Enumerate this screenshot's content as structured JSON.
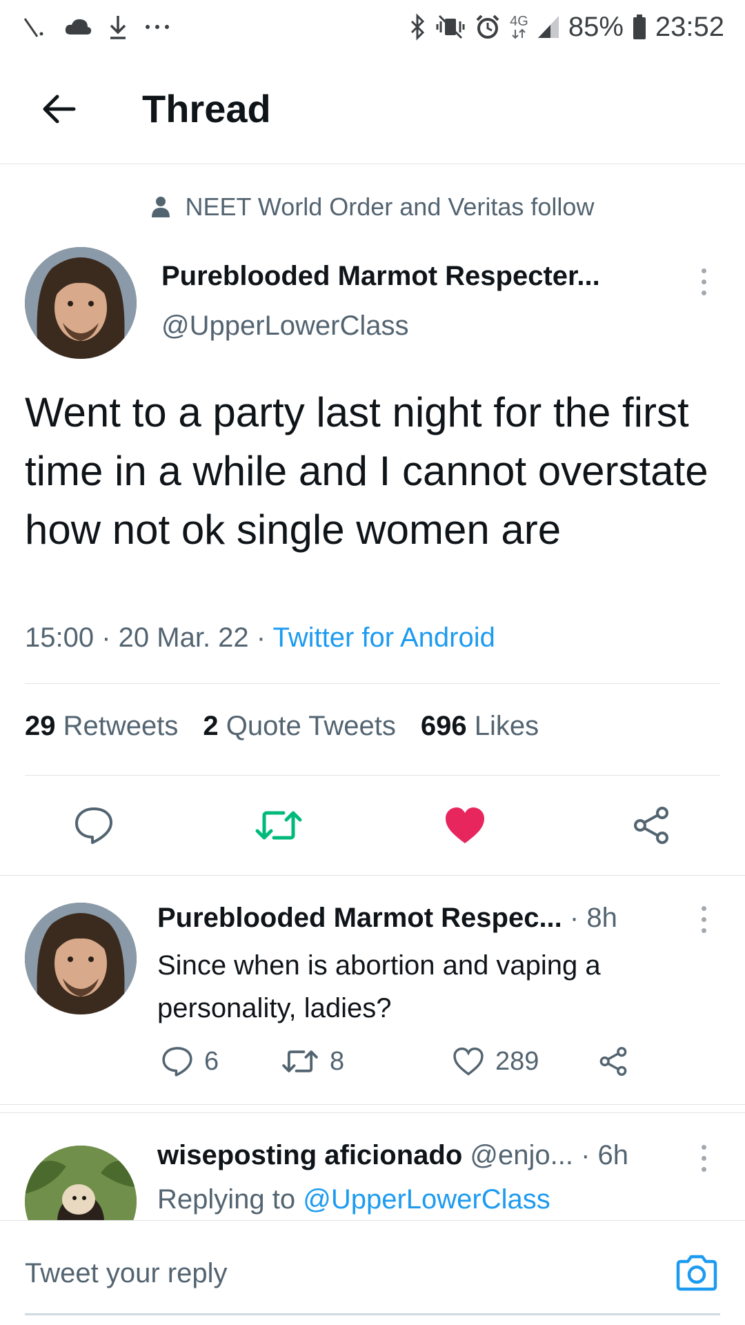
{
  "status_bar": {
    "battery": "85%",
    "time": "23:52",
    "network": "4G",
    "icons": [
      "signal-slash-icon",
      "cloud-icon",
      "download-icon",
      "more-dots-icon",
      "bluetooth-icon",
      "vibrate-mute-icon",
      "alarm-icon",
      "network-4g-icon",
      "cell-signal-icon",
      "battery-icon"
    ]
  },
  "header": {
    "title": "Thread",
    "back_icon": "arrow-left-icon"
  },
  "social_context": {
    "icon": "person-icon",
    "text": "NEET World Order and Veritas follow"
  },
  "main_tweet": {
    "display_name": "Pureblooded Marmot Respecter...",
    "handle": "@UpperLowerClass",
    "text": "Went to a party last night for the first time in a while and I cannot overstate how not ok single women are",
    "time": "15:00",
    "date": "20 Mar. 22",
    "source": "Twitter for Android",
    "stats": {
      "retweets_count": "29",
      "retweets_label": "Retweets",
      "quotes_count": "2",
      "quotes_label": "Quote Tweets",
      "likes_count": "696",
      "likes_label": "Likes"
    },
    "liked": true,
    "retweeted": true
  },
  "reply_tweet": {
    "display_name": "Pureblooded Marmot Respec...",
    "time_ago": "8h",
    "text": "Since when is abortion and vaping a personality, ladies?",
    "replies": "6",
    "retweets": "8",
    "likes": "289"
  },
  "third_tweet": {
    "display_name": "wiseposting aficionado",
    "handle": "@enjo...",
    "time_ago": "6h",
    "replying_prefix": "Replying to",
    "replying_to": "@UpperLowerClass"
  },
  "composer": {
    "placeholder": "Tweet your reply"
  },
  "colors": {
    "accent": "#1d9bf0",
    "retweet_green": "#00ba7c",
    "like_pink": "#f91880",
    "secondary_text": "#536471"
  }
}
